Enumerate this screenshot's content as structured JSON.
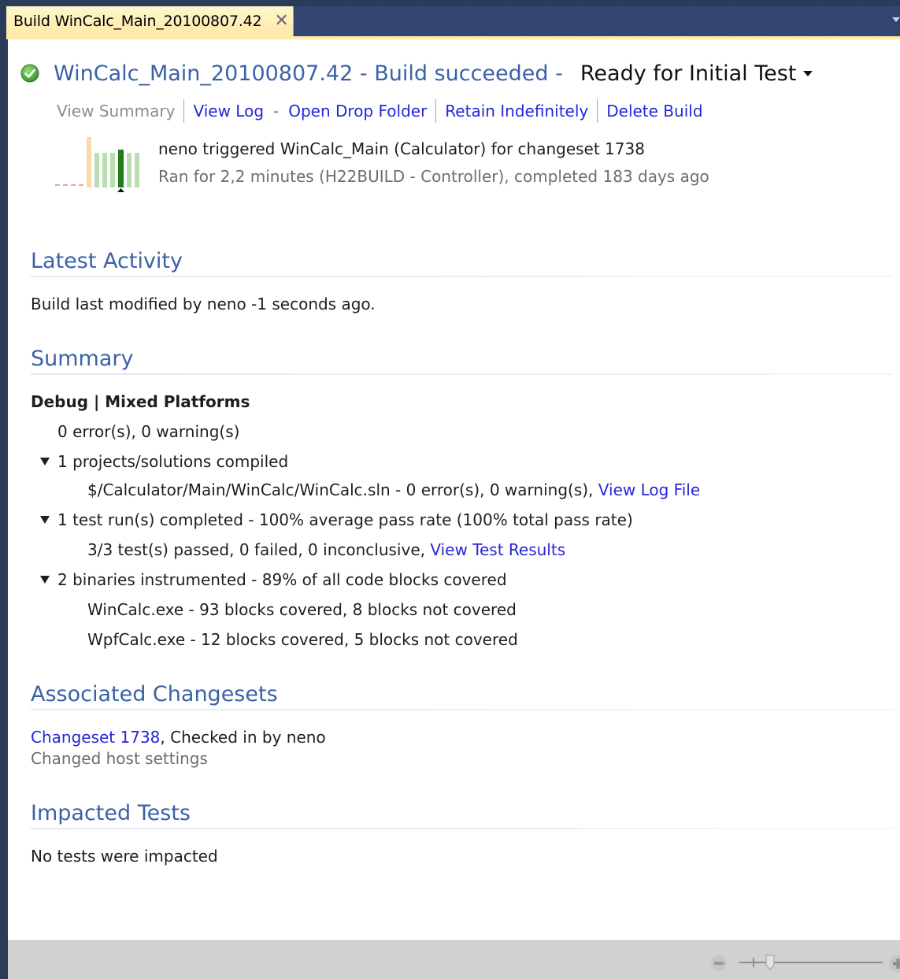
{
  "tab": {
    "title": "Build WinCalc_Main_20100807.42",
    "close_glyph": "✕"
  },
  "header": {
    "title": "WinCalc_Main_20100807.42 - Build succeeded -",
    "quality": "Ready for Initial Test",
    "status_color": "#4caf50"
  },
  "actions": {
    "view_summary": "View Summary",
    "view_log": "View Log",
    "dash": "-",
    "open_drop_folder": "Open Drop Folder",
    "retain": "Retain Indefinitely",
    "delete": "Delete Build"
  },
  "details": {
    "trigger": "neno triggered WinCalc_Main (Calculator) for changeset 1738",
    "ran": "Ran for 2,2 minutes (H22BUILD - Controller), completed 183 days ago"
  },
  "latest_activity": {
    "title": "Latest Activity",
    "text": "Build last modified by neno -1 seconds ago."
  },
  "summary": {
    "title": "Summary",
    "config": "Debug | Mixed Platforms",
    "errors": "0 error(s), 0 warning(s)",
    "compiled": "1 projects/solutions compiled",
    "solution": "$/Calculator/Main/WinCalc/WinCalc.sln - 0 error(s), 0 warning(s),",
    "view_log_file": "View Log File",
    "tests": "1 test run(s) completed - 100% average pass rate (100% total pass rate)",
    "tests_detail": "3/3 test(s) passed, 0 failed, 0 inconclusive,",
    "view_test_results": "View Test Results",
    "coverage": "2 binaries instrumented - 89% of all code blocks covered",
    "binaries": [
      "WinCalc.exe - 93 blocks covered, 8 blocks not covered",
      "WpfCalc.exe - 12 blocks covered, 5 blocks not covered"
    ]
  },
  "changesets": {
    "title": "Associated Changesets",
    "link": "Changeset 1738",
    "checked_in": ", Checked in by neno",
    "comment": "Changed host settings"
  },
  "impacted": {
    "title": "Impacted Tests",
    "text": "No tests were impacted"
  },
  "colors": {
    "link": "#2626d9",
    "heading": "#3a62a8",
    "tab_active": "#ffe8a6"
  }
}
